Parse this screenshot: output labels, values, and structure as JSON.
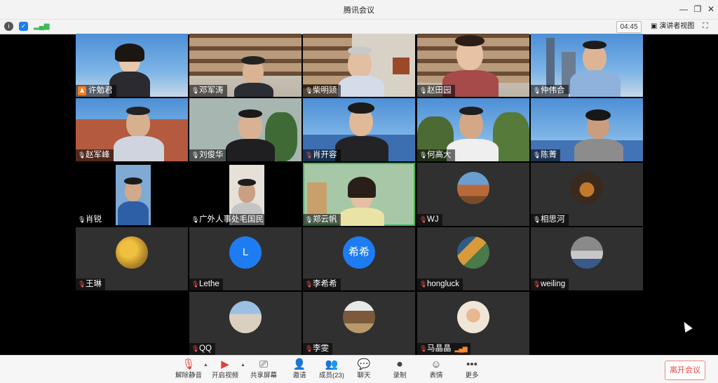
{
  "window": {
    "title": "腾讯会议",
    "controls": {
      "minimize": "—",
      "restore": "❐",
      "close": "✕"
    }
  },
  "infobar": {
    "timer": "04:45",
    "speaker_view_label": "演讲者视图"
  },
  "participants": [
    {
      "name": "许勉君",
      "host": true
    },
    {
      "name": "邓军涛"
    },
    {
      "name": "柴明颎"
    },
    {
      "name": "赵田园"
    },
    {
      "name": "仲伟合"
    },
    {
      "name": "赵军峰"
    },
    {
      "name": "刘俊华"
    },
    {
      "name": "肖开容"
    },
    {
      "name": "何高大"
    },
    {
      "name": "陈菁"
    },
    {
      "name": "肖锐"
    },
    {
      "name": "广外人事处毛国民"
    },
    {
      "name": "郑云帆"
    },
    {
      "name": "WJ"
    },
    {
      "name": "相思河"
    },
    {
      "name": "王琳"
    },
    {
      "name": "Lethe",
      "avatar_letter": "L"
    },
    {
      "name": "李希希",
      "avatar_letter": "希希"
    },
    {
      "name": "hongluck"
    },
    {
      "name": "weiling"
    },
    {
      "name": "QQ"
    },
    {
      "name": "李雯"
    },
    {
      "name": "马晶晶"
    }
  ],
  "toolbar": {
    "unmute": "解除静音",
    "start_video": "开启视频",
    "share_screen": "共享屏幕",
    "invite": "邀请",
    "members": "成员(23)",
    "chat": "聊天",
    "record": "录制",
    "reactions": "表情",
    "more": "更多",
    "leave": "离开会议"
  },
  "colors": {
    "accent_blue": "#1e7cf2",
    "leave_red": "#e5483c",
    "muted_red": "#ff5a5a",
    "active_green": "#3cba54"
  }
}
